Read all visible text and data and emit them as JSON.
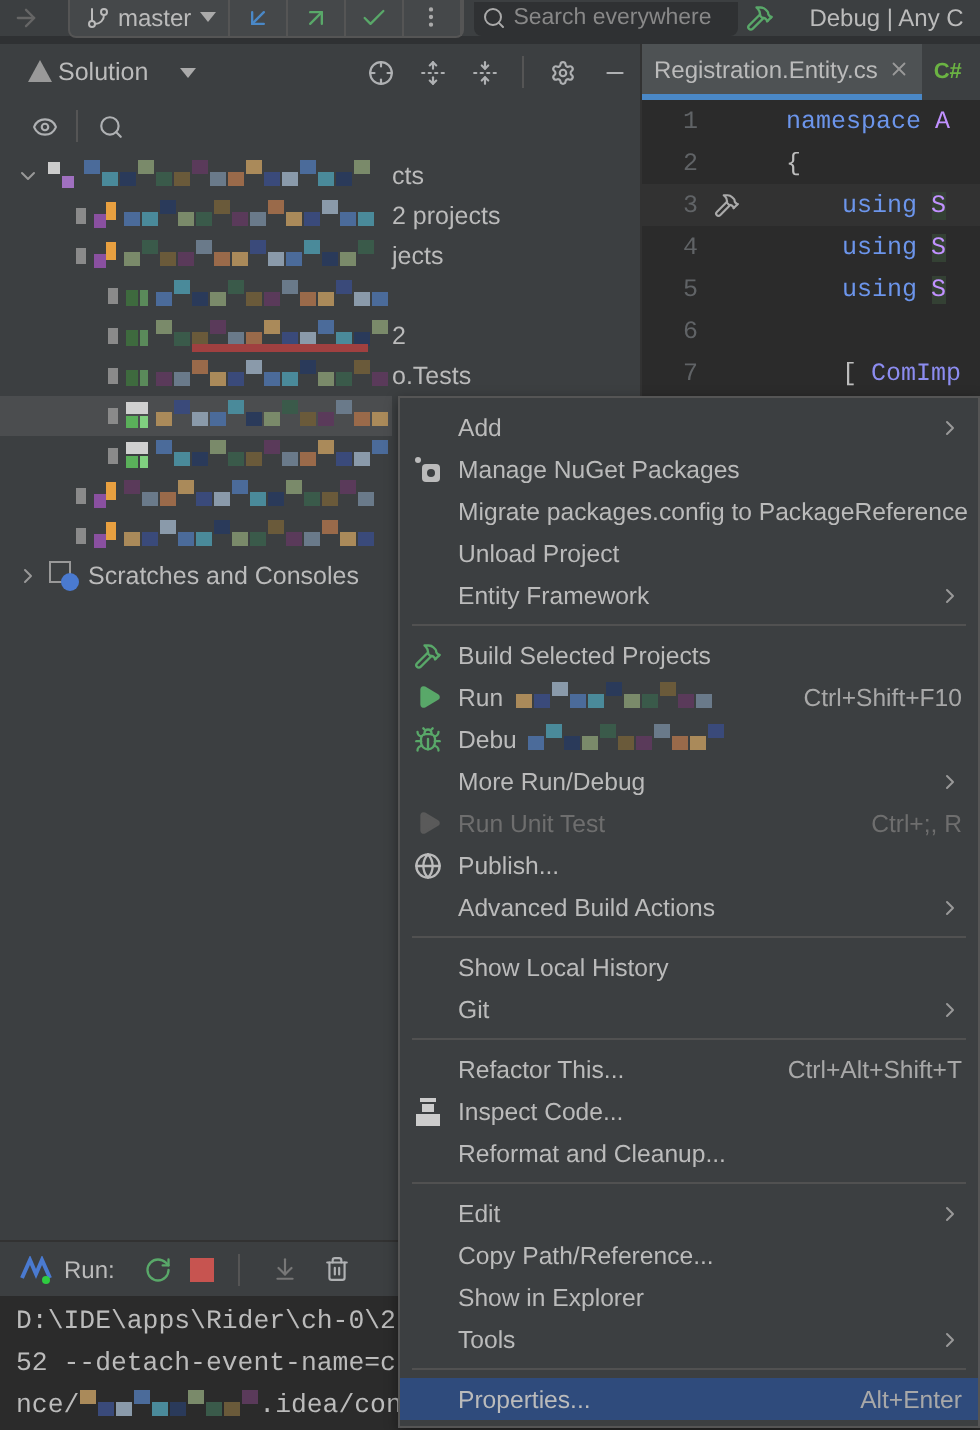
{
  "toolbar": {
    "branch": "master",
    "search": {
      "placeholder": "Search everywhere"
    },
    "run_configuration": "Debug | Any C"
  },
  "solution": {
    "title": "Solution",
    "tree": [
      {
        "kind": "solution",
        "name": "cts",
        "expanded": true,
        "selected": false,
        "children": [
          {
            "kind": "project",
            "name": "2 projects",
            "selected": false
          },
          {
            "kind": "project",
            "name": "jects",
            "selected": false,
            "children": [
              {
                "kind": "code",
                "selected": false
              },
              {
                "kind": "code",
                "name": "2",
                "selected": false
              },
              {
                "kind": "code",
                "name": "o.Tests",
                "selected": false
              },
              {
                "kind": "test",
                "selected": true
              },
              {
                "kind": "test",
                "selected": false
              }
            ]
          },
          {
            "kind": "project",
            "selected": false
          },
          {
            "kind": "project",
            "selected": false
          }
        ]
      },
      {
        "kind": "scratches",
        "name": "Scratches and Consoles",
        "expanded": false,
        "selected": false
      }
    ]
  },
  "editor": {
    "tabs": [
      {
        "label": "Registration.Entity.cs",
        "selected": true
      },
      {
        "badge": "C#",
        "selected": false
      }
    ],
    "lines": [
      {
        "number": "1",
        "current": false,
        "tokens": [
          {
            "kind": "keyword",
            "text": "namespace"
          },
          {
            "kind": "name",
            "text": "A"
          }
        ]
      },
      {
        "number": "2",
        "current": false,
        "tokens": [
          {
            "kind": "plain",
            "text": "{"
          }
        ]
      },
      {
        "number": "3",
        "current": true,
        "tokens": [
          {
            "kind": "indent"
          },
          {
            "kind": "keyword",
            "text": "using"
          },
          {
            "kind": "name",
            "text": "S"
          }
        ]
      },
      {
        "number": "4",
        "current": false,
        "tokens": [
          {
            "kind": "indent"
          },
          {
            "kind": "keyword",
            "text": "using"
          },
          {
            "kind": "name",
            "text": "S"
          }
        ]
      },
      {
        "number": "5",
        "current": false,
        "tokens": [
          {
            "kind": "indent"
          },
          {
            "kind": "keyword",
            "text": "using"
          },
          {
            "kind": "name",
            "text": "S"
          }
        ]
      },
      {
        "number": "6",
        "current": false
      },
      {
        "number": "7",
        "current": false,
        "tokens": [
          {
            "kind": "indent"
          },
          {
            "kind": "plain",
            "text": "["
          },
          {
            "kind": "attribute",
            "text": "ComImp"
          }
        ]
      }
    ]
  },
  "run": {
    "title": "Run:",
    "console": [
      {
        "segments": [
          {
            "kind": "text",
            "text": "D:\\IDE\\apps\\Rider\\ch-0\\2"
          }
        ]
      },
      {
        "segments": [
          {
            "kind": "text",
            "text": "52 --detach-event-name=c"
          }
        ]
      },
      {
        "segments": [
          {
            "kind": "text",
            "text": "nce/"
          },
          {
            "kind": "redacted"
          },
          {
            "kind": "text",
            "text": ".idea/con"
          }
        ]
      }
    ]
  },
  "context_menu": {
    "items": [
      {
        "kind": "item",
        "label": "Add",
        "submenu": true,
        "disabled": false,
        "selected": false
      },
      {
        "kind": "nuget",
        "label": "Manage NuGet Packages",
        "disabled": false,
        "selected": false
      },
      {
        "kind": "item",
        "label": "Migrate packages.config to PackageReference",
        "disabled": false,
        "selected": false
      },
      {
        "kind": "item",
        "label": "Unload Project",
        "disabled": false,
        "selected": false
      },
      {
        "kind": "item",
        "label": "Entity Framework",
        "submenu": true,
        "disabled": false,
        "selected": false
      },
      {
        "kind": "separator"
      },
      {
        "kind": "build",
        "label": "Build Selected Projects",
        "disabled": false,
        "selected": false
      },
      {
        "kind": "run",
        "label": "Run",
        "redacted": true,
        "shortcut": "Ctrl+Shift+F10",
        "disabled": false,
        "selected": false
      },
      {
        "kind": "debug",
        "label": "Debu",
        "redacted": true,
        "disabled": false,
        "selected": false
      },
      {
        "kind": "item",
        "label": "More Run/Debug",
        "submenu": true,
        "disabled": false,
        "selected": false
      },
      {
        "kind": "run",
        "label": "Run Unit Test",
        "shortcut": "Ctrl+;, R",
        "disabled": true,
        "selected": false
      },
      {
        "kind": "publish",
        "label": "Publish...",
        "disabled": false,
        "selected": false
      },
      {
        "kind": "item",
        "label": "Advanced Build Actions",
        "submenu": true,
        "disabled": false,
        "selected": false
      },
      {
        "kind": "separator"
      },
      {
        "kind": "item",
        "label": "Show Local History",
        "disabled": false,
        "selected": false
      },
      {
        "kind": "item",
        "label": "Git",
        "submenu": true,
        "disabled": false,
        "selected": false
      },
      {
        "kind": "separator"
      },
      {
        "kind": "item",
        "label": "Refactor This...",
        "shortcut": "Ctrl+Alt+Shift+T",
        "disabled": false,
        "selected": false
      },
      {
        "kind": "inspect",
        "label": "Inspect Code...",
        "disabled": false,
        "selected": false
      },
      {
        "kind": "item",
        "label": "Reformat and Cleanup...",
        "disabled": false,
        "selected": false
      },
      {
        "kind": "separator"
      },
      {
        "kind": "item",
        "label": "Edit",
        "submenu": true,
        "disabled": false,
        "selected": false
      },
      {
        "kind": "item",
        "label": "Copy Path/Reference...",
        "disabled": false,
        "selected": false
      },
      {
        "kind": "item",
        "label": "Show in Explorer",
        "disabled": false,
        "selected": false
      },
      {
        "kind": "item",
        "label": "Tools",
        "submenu": true,
        "disabled": false,
        "selected": false
      },
      {
        "kind": "separator"
      },
      {
        "kind": "item",
        "label": "Properties...",
        "shortcut": "Alt+Enter",
        "disabled": false,
        "selected": true
      }
    ]
  }
}
